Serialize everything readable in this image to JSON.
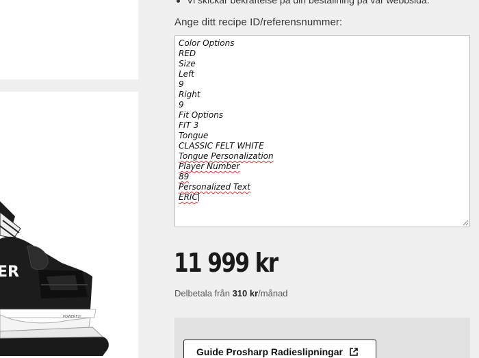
{
  "top_note": "Vi skickar bekräftelse på din beställning på vår webbsida.",
  "recipe": {
    "label": "Ange ditt recipe ID/referensnummer:",
    "lines": [
      "Color Options",
      "RED",
      "Size",
      "Left",
      "9",
      "Right",
      "9",
      "Fit Options",
      "FIT 3",
      "Tongue",
      "CLASSIC FELT WHITE",
      "Tongue Personalization",
      "Player Number",
      "89",
      "Personalized Text",
      "ERIC"
    ]
  },
  "price": {
    "amount": "11 999 kr",
    "installment_prefix": "Delbetala från",
    "installment_amount": "310 kr",
    "installment_suffix": "/månad"
  },
  "guide": {
    "button_label": "Guide Prosharp Radieslipningar",
    "icon": "external-link-icon"
  },
  "product_image": {
    "brand_text": "ER",
    "model_text": "POWERFLY"
  }
}
